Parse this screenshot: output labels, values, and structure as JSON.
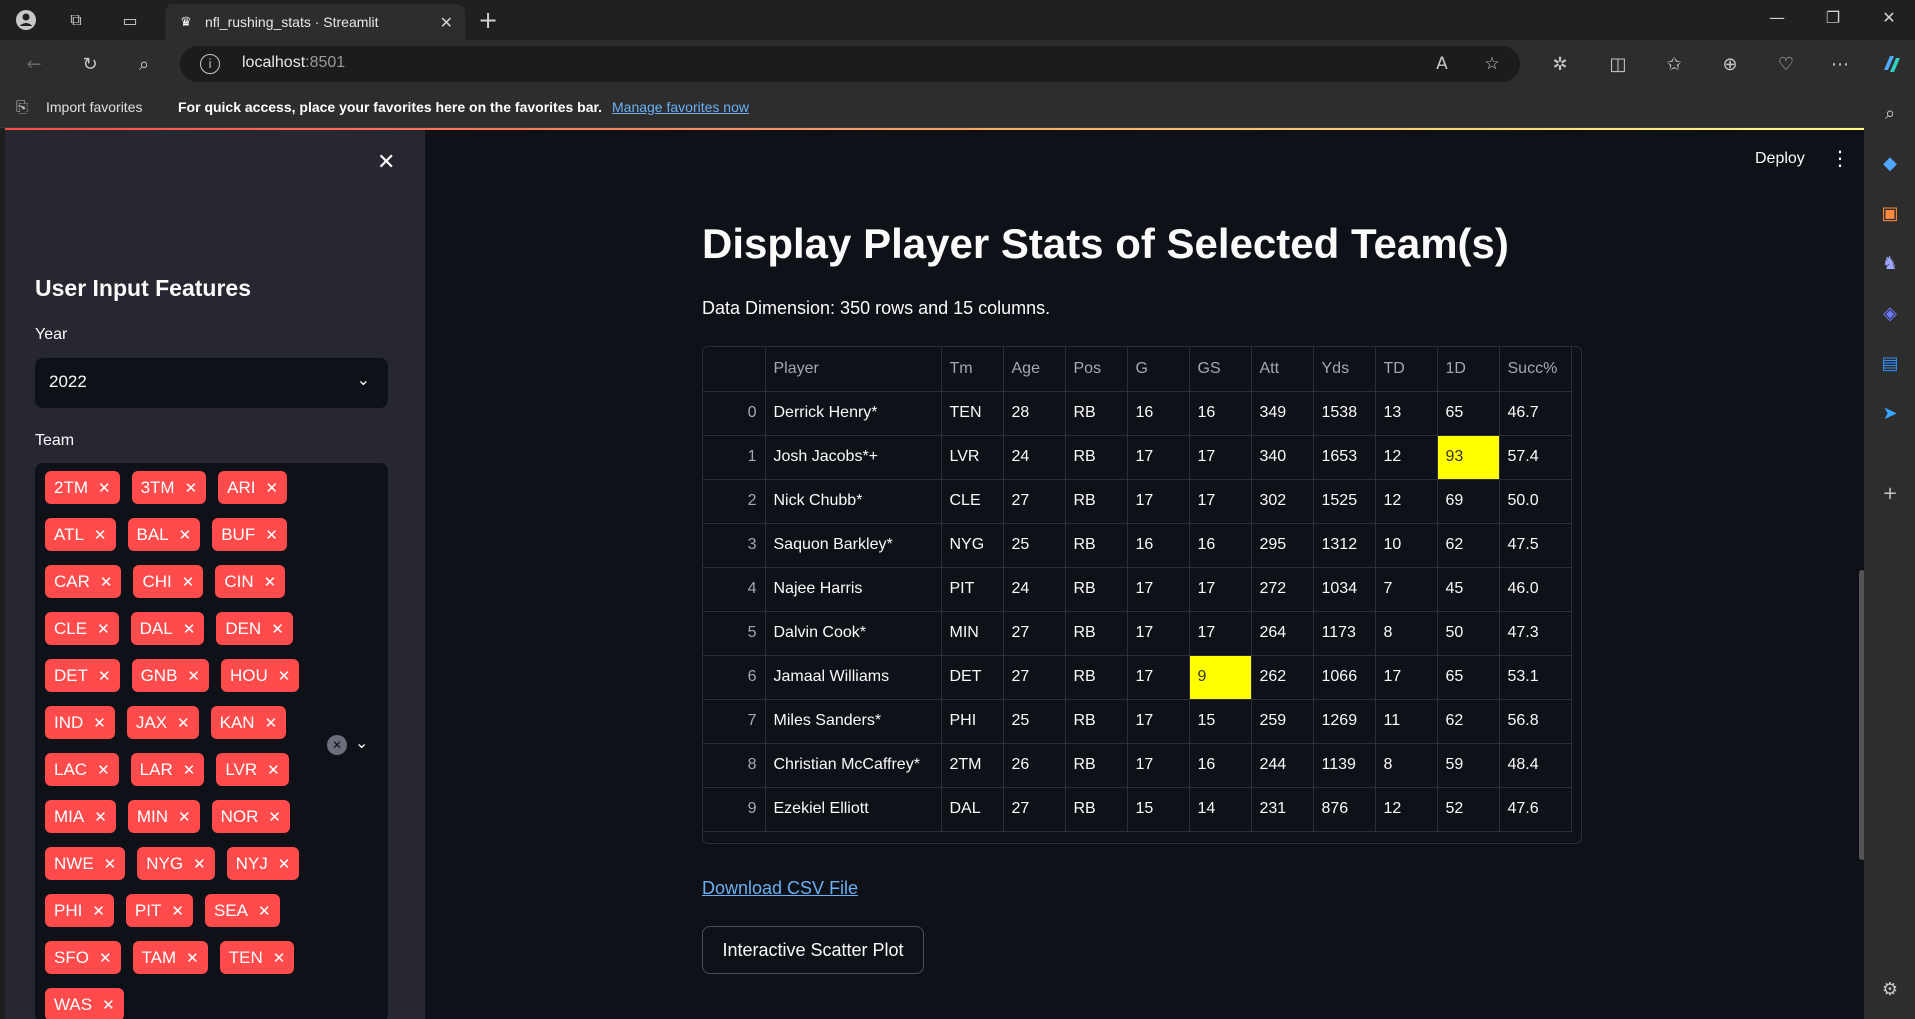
{
  "browser": {
    "tab_title": "nfl_rushing_stats · Streamlit",
    "url_host": "localhost",
    "url_port": ":8501"
  },
  "favorites": {
    "import_label": "Import favorites",
    "message": "For quick access, place your favorites here on the favorites bar.",
    "link": "Manage favorites now"
  },
  "sidebar": {
    "header": "User Input Features",
    "year_label": "Year",
    "year_value": "2022",
    "team_label": "Team",
    "teams": [
      "2TM",
      "3TM",
      "ARI",
      "ATL",
      "BAL",
      "BUF",
      "CAR",
      "CHI",
      "CIN",
      "CLE",
      "DAL",
      "DEN",
      "DET",
      "GNB",
      "HOU",
      "IND",
      "JAX",
      "KAN",
      "LAC",
      "LAR",
      "LVR",
      "MIA",
      "MIN",
      "NOR",
      "NWE",
      "NYG",
      "NYJ",
      "PHI",
      "PIT",
      "SEA",
      "SFO",
      "TAM",
      "TEN",
      "WAS"
    ]
  },
  "header": {
    "deploy_label": "Deploy"
  },
  "main": {
    "title": "Display Player Stats of Selected Team(s)",
    "dimension_text": "Data Dimension: 350 rows and 15 columns.",
    "download_link": "Download CSV File",
    "scatter_button": "Interactive Scatter Plot"
  },
  "table": {
    "columns": [
      "",
      "Player",
      "Tm",
      "Age",
      "Pos",
      "G",
      "GS",
      "Att",
      "Yds",
      "TD",
      "1D",
      "Succ%"
    ],
    "rows": [
      [
        "0",
        "Derrick Henry*",
        "TEN",
        "28",
        "RB",
        "16",
        "16",
        "349",
        "1538",
        "13",
        "65",
        "46.7"
      ],
      [
        "1",
        "Josh Jacobs*+",
        "LVR",
        "24",
        "RB",
        "17",
        "17",
        "340",
        "1653",
        "12",
        "93",
        "57.4"
      ],
      [
        "2",
        "Nick Chubb*",
        "CLE",
        "27",
        "RB",
        "17",
        "17",
        "302",
        "1525",
        "12",
        "69",
        "50.0"
      ],
      [
        "3",
        "Saquon Barkley*",
        "NYG",
        "25",
        "RB",
        "16",
        "16",
        "295",
        "1312",
        "10",
        "62",
        "47.5"
      ],
      [
        "4",
        "Najee Harris",
        "PIT",
        "24",
        "RB",
        "17",
        "17",
        "272",
        "1034",
        "7",
        "45",
        "46.0"
      ],
      [
        "5",
        "Dalvin Cook*",
        "MIN",
        "27",
        "RB",
        "17",
        "17",
        "264",
        "1173",
        "8",
        "50",
        "47.3"
      ],
      [
        "6",
        "Jamaal Williams",
        "DET",
        "27",
        "RB",
        "17",
        "9",
        "262",
        "1066",
        "17",
        "65",
        "53.1"
      ],
      [
        "7",
        "Miles Sanders*",
        "PHI",
        "25",
        "RB",
        "17",
        "15",
        "259",
        "1269",
        "11",
        "62",
        "56.8"
      ],
      [
        "8",
        "Christian McCaffrey*",
        "2TM",
        "26",
        "RB",
        "17",
        "16",
        "244",
        "1139",
        "8",
        "59",
        "48.4"
      ],
      [
        "9",
        "Ezekiel Elliott",
        "DAL",
        "27",
        "RB",
        "15",
        "14",
        "231",
        "876",
        "12",
        "52",
        "47.6"
      ]
    ],
    "highlight_color": "#ffff00"
  }
}
